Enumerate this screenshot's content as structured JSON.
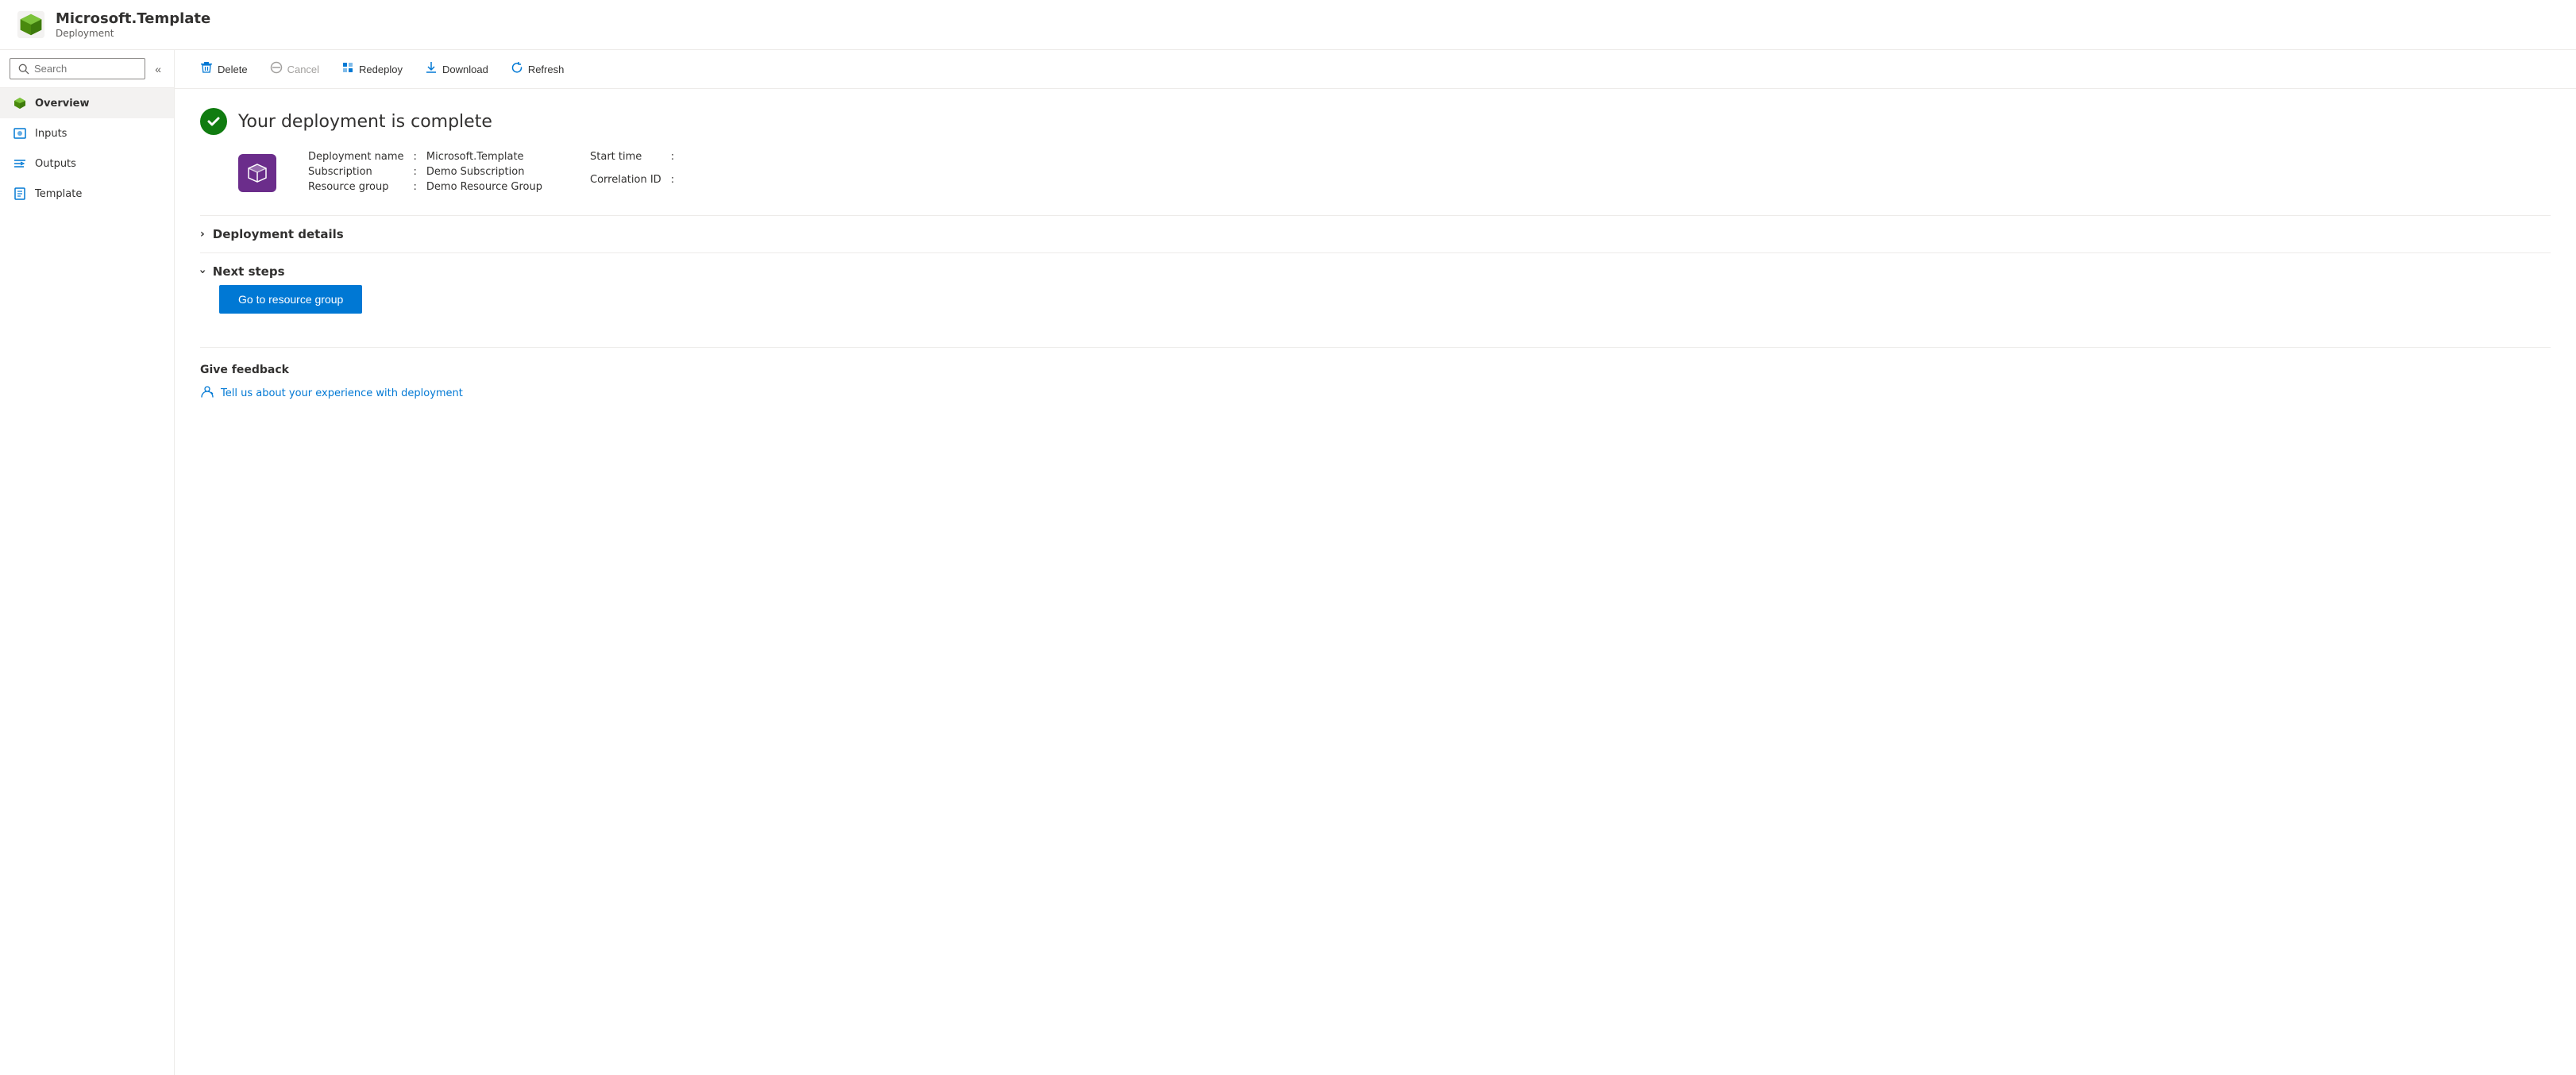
{
  "header": {
    "title": "Microsoft.Template",
    "subtitle": "Deployment"
  },
  "sidebar": {
    "search_placeholder": "Search",
    "collapse_label": "«",
    "nav_items": [
      {
        "id": "overview",
        "label": "Overview",
        "active": true
      },
      {
        "id": "inputs",
        "label": "Inputs",
        "active": false
      },
      {
        "id": "outputs",
        "label": "Outputs",
        "active": false
      },
      {
        "id": "template",
        "label": "Template",
        "active": false
      }
    ]
  },
  "toolbar": {
    "buttons": [
      {
        "id": "delete",
        "label": "Delete",
        "icon": "🗑",
        "disabled": false
      },
      {
        "id": "cancel",
        "label": "Cancel",
        "icon": "⊘",
        "disabled": true
      },
      {
        "id": "redeploy",
        "label": "Redeploy",
        "icon": "⇅",
        "disabled": false
      },
      {
        "id": "download",
        "label": "Download",
        "icon": "⬇",
        "disabled": false
      },
      {
        "id": "refresh",
        "label": "Refresh",
        "icon": "↻",
        "disabled": false
      }
    ]
  },
  "main": {
    "success_title": "Your deployment is complete",
    "deployment_details": {
      "name_label": "Deployment name",
      "name_value": "Microsoft.Template",
      "subscription_label": "Subscription",
      "subscription_value": "Demo Subscription",
      "resource_group_label": "Resource group",
      "resource_group_value": "Demo Resource Group",
      "start_time_label": "Start time",
      "start_time_value": "",
      "correlation_id_label": "Correlation ID",
      "correlation_id_value": ""
    },
    "sections": [
      {
        "id": "deployment-details",
        "label": "Deployment details",
        "expanded": false
      },
      {
        "id": "next-steps",
        "label": "Next steps",
        "expanded": true
      }
    ],
    "go_to_resource_group_label": "Go to resource group",
    "feedback": {
      "title": "Give feedback",
      "link_text": "Tell us about your experience with deployment"
    }
  }
}
